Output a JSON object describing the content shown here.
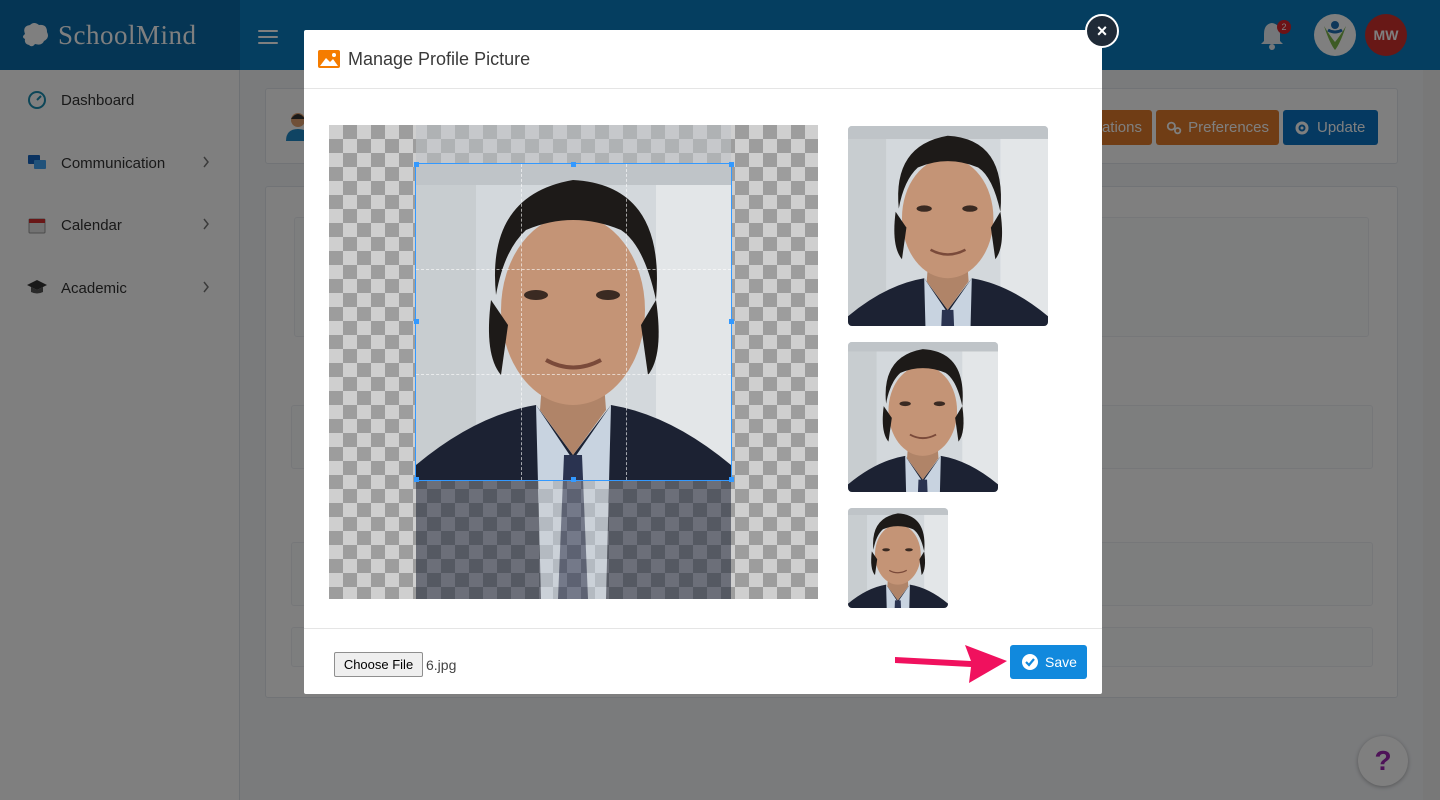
{
  "app": {
    "brand": "SchoolMind",
    "notification_count": "2",
    "user_initials": "MW"
  },
  "sidebar": {
    "items": [
      {
        "label": "Dashboard",
        "icon": "dashboard-icon"
      },
      {
        "label": "Communication",
        "icon": "chat-icon"
      },
      {
        "label": "Calendar",
        "icon": "calendar-icon"
      },
      {
        "label": "Academic",
        "icon": "graduation-cap-icon"
      }
    ]
  },
  "header_buttons": {
    "notifications_partial": "ations",
    "preferences": "Preferences",
    "update": "Update"
  },
  "modal": {
    "title": "Manage Profile Picture",
    "close_label": "×",
    "choose_file_label": "Choose File",
    "file_name": "6.jpg",
    "save_label": "Save"
  },
  "help": {
    "label": "?"
  },
  "colors": {
    "topbar": "#0a7cc1",
    "orange_button": "#e07b2a",
    "blue_button": "#0b73c2",
    "save_button": "#1189dd",
    "arrow": "#f0115e"
  }
}
